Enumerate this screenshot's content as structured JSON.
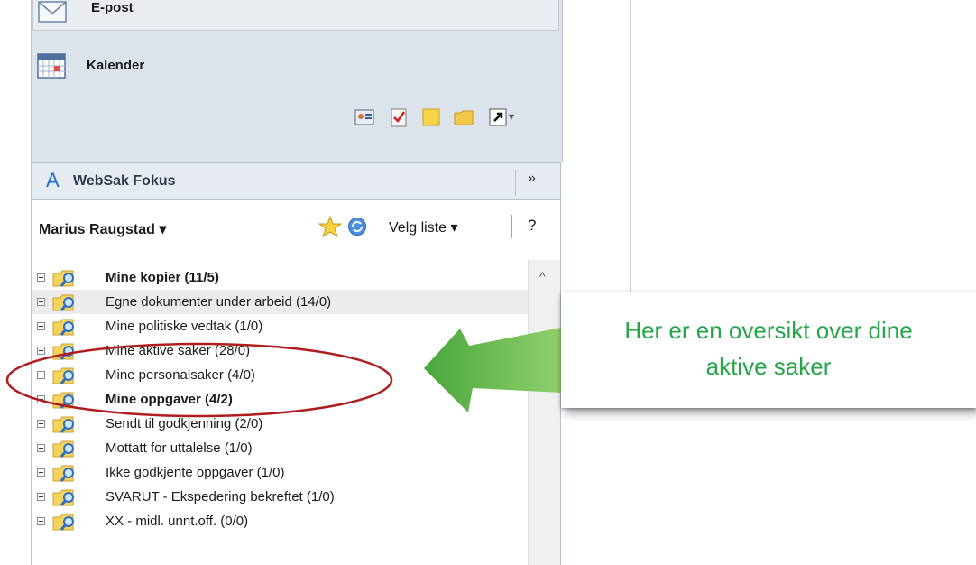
{
  "nav": {
    "email_label": "E-post",
    "calendar_label": "Kalender",
    "shortcuts": [
      "contacts-icon",
      "tasks-icon",
      "notes-icon",
      "folder-icon",
      "shortcut-icon"
    ],
    "shortcuts_more": "▾"
  },
  "plugin": {
    "logo": "A",
    "title": "WebSak Fokus",
    "collapse": "»"
  },
  "toolbar": {
    "user": "Marius Raugstad ▾",
    "velg_liste": "Velg liste ▾",
    "help": "?"
  },
  "list": {
    "items": [
      {
        "label": "Mine kopier (11/5)",
        "bold": true
      },
      {
        "label": "Egne dokumenter under arbeid (14/0)",
        "bold": false
      },
      {
        "label": "Mine politiske vedtak (1/0)",
        "bold": false
      },
      {
        "label": "Mine aktive saker (28/0)",
        "bold": false
      },
      {
        "label": "Mine personalsaker (4/0)",
        "bold": false
      },
      {
        "label": "Mine oppgaver (4/2)",
        "bold": true
      },
      {
        "label": "Sendt til godkjenning (2/0)",
        "bold": false
      },
      {
        "label": "Mottatt for uttalelse (1/0)",
        "bold": false
      },
      {
        "label": "Ikke godkjente oppgaver (1/0)",
        "bold": false
      },
      {
        "label": "SVARUT - Ekspedering bekreftet (1/0)",
        "bold": false
      },
      {
        "label": "XX - midl. unnt.off. (0/0)",
        "bold": false
      }
    ]
  },
  "callout": {
    "line1": "Her er en oversikt over dine",
    "line2": "aktive saker"
  },
  "colors": {
    "callout_text": "#27a54a",
    "arrow": "#5bb84a",
    "ellipse": "#b01d1d"
  }
}
